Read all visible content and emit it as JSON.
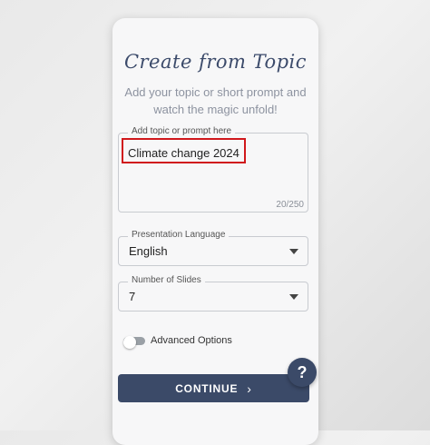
{
  "header": {
    "title": "Create from Topic"
  },
  "intro": {
    "text": "Add your topic or short prompt and watch the magic unfold!"
  },
  "topic_field": {
    "label": "Add topic or prompt here",
    "value": "Climate change 2024",
    "counter": "20/250"
  },
  "language_field": {
    "label": "Presentation Language",
    "value": "English"
  },
  "slides_field": {
    "label": "Number of Slides",
    "value": "7"
  },
  "advanced": {
    "label": "Advanced Options",
    "enabled": false
  },
  "actions": {
    "continue_label": "CONTINUE",
    "continue_icon": "›"
  },
  "help": {
    "icon_char": "?"
  },
  "colors": {
    "accent": "#3b4a68",
    "highlight": "#d0181c",
    "card_background": "#f7f7f8"
  }
}
